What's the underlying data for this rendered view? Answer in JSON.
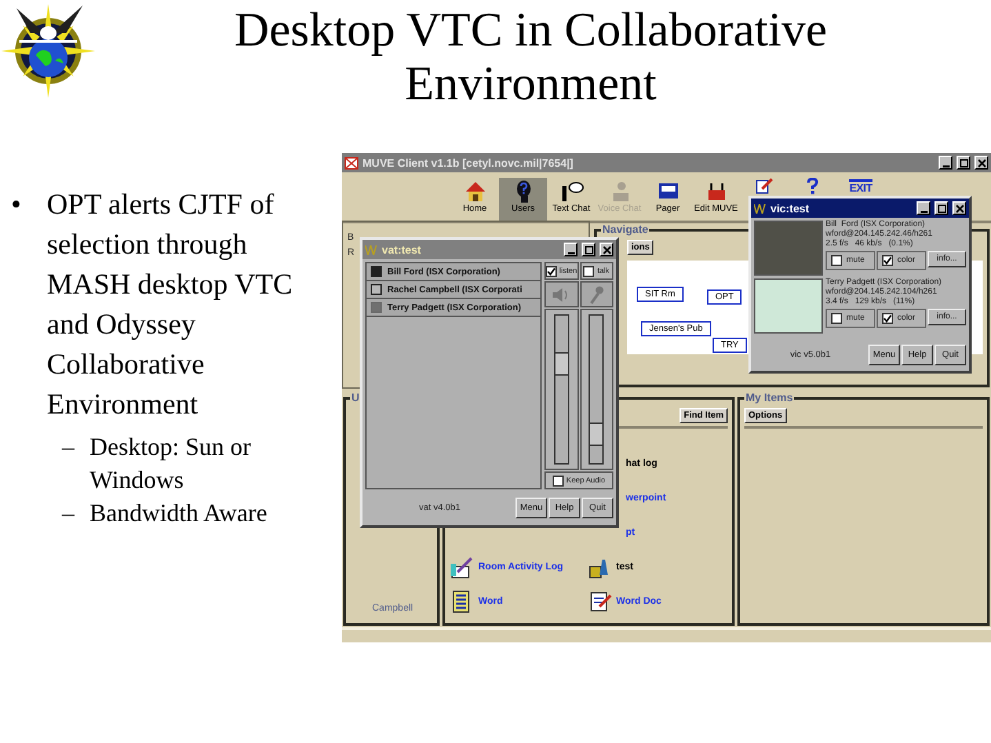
{
  "title": "Desktop VTC in Collaborative Environment",
  "bullets": [
    {
      "marker": "•",
      "text": "OPT alerts CJTF of selection through MASH desktop VTC and Odyssey Collaborative Environment",
      "children": [
        {
          "marker": "–",
          "text": "Desktop: Sun or Windows"
        },
        {
          "marker": "–",
          "text": "Bandwidth Aware"
        }
      ]
    }
  ],
  "muve": {
    "title": "MUVE Client v1.1b [cetyl.novc.mil|7654|]",
    "toolbar": [
      {
        "label": "Home",
        "selected": false,
        "disabled": false
      },
      {
        "label": "Users",
        "selected": true,
        "disabled": false
      },
      {
        "label": "Text Chat",
        "selected": false,
        "disabled": false
      },
      {
        "label": "Voice Chat",
        "selected": false,
        "disabled": true
      },
      {
        "label": "Pager",
        "selected": false,
        "disabled": false
      },
      {
        "label": "Edit MUVE",
        "selected": false,
        "disabled": false
      }
    ],
    "exit_icon": "EXIT",
    "left_panel": [
      "B",
      "R"
    ],
    "navigate": {
      "legend": "Navigate",
      "button": "ions",
      "rooms": [
        "SIT Rm",
        "OPT",
        "Jensen's Pub",
        "TRY"
      ]
    },
    "users": {
      "legend": "U",
      "names": [
        "Campbell"
      ]
    },
    "items": {
      "button": "Find Item",
      "left": [
        {
          "label": "Room Activity Log",
          "kind": "icon",
          "link": true
        },
        {
          "label": "Word",
          "kind": "icon",
          "link": true
        }
      ],
      "right": [
        {
          "label": "hat log",
          "kind": "text",
          "link": false
        },
        {
          "label": "werpoint",
          "kind": "text",
          "link": true
        },
        {
          "label": "pt",
          "kind": "text",
          "link": true
        },
        {
          "label": "test",
          "kind": "icon",
          "link": false
        },
        {
          "label": "Word Doc",
          "kind": "icon",
          "link": true
        }
      ]
    },
    "my_items": {
      "legend": "My Items",
      "button": "Options"
    }
  },
  "vat": {
    "title": "vat:test",
    "participants": [
      {
        "name": "Bill Ford (ISX Corporation)",
        "checked": true,
        "dimmed": false
      },
      {
        "name": "Rachel Campbell  (ISX Corporati",
        "checked": false,
        "dimmed": false
      },
      {
        "name": "Terry Padgett (ISX Corporation)",
        "checked": true,
        "dimmed": true
      }
    ],
    "listen": {
      "label": "listen",
      "checked": true
    },
    "talk": {
      "label": "talk",
      "checked": false
    },
    "sliders": [
      {
        "level": 0.67
      },
      {
        "level": 0.2
      }
    ],
    "keep_audio": {
      "label": "Keep Audio",
      "checked": false
    },
    "status": "vat v4.0b1",
    "buttons": [
      "Menu",
      "Help",
      "Quit"
    ]
  },
  "vic": {
    "title": "vic:test",
    "sources": [
      {
        "name": "Bill  Ford (ISX Corporation)",
        "address": "wford@204.145.242.46/h261",
        "stats": "2.5 f/s   46 kb/s   (0.1%)",
        "mute": {
          "label": "mute",
          "checked": false
        },
        "color": {
          "label": "color",
          "checked": true
        },
        "info": "info..."
      },
      {
        "name": "Terry Padgett (ISX Corporation)",
        "address": "wford@204.145.242.104/h261",
        "stats": "3.4 f/s   129 kb/s   (11%)",
        "mute": {
          "label": "mute",
          "checked": false
        },
        "color": {
          "label": "color",
          "checked": true
        },
        "info": "info..."
      }
    ],
    "status": "vic v5.0b1",
    "buttons": [
      "Menu",
      "Help",
      "Quit"
    ]
  }
}
